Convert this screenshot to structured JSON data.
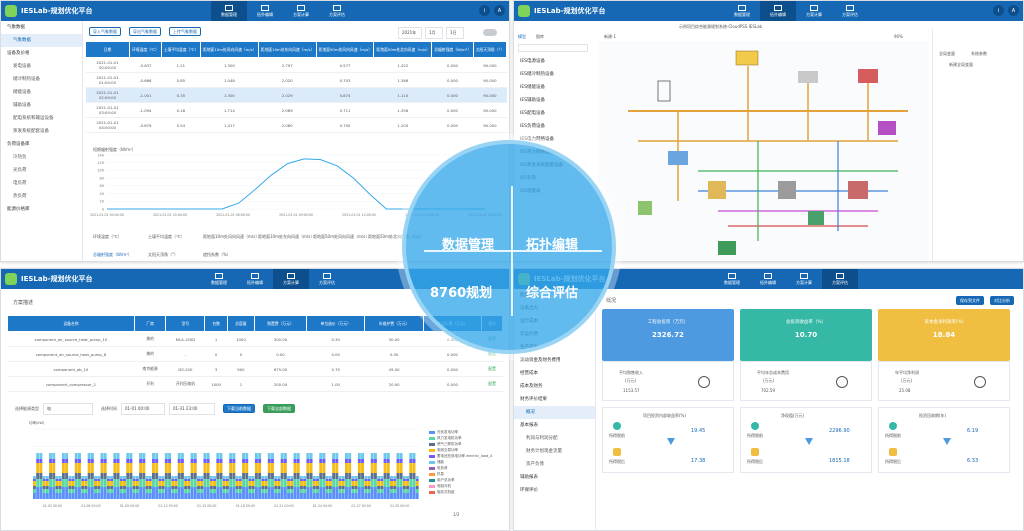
{
  "overlay": {
    "q1": "数据管理",
    "q2": "拓扑编辑",
    "q3": "8760规划",
    "q4": "综合评估"
  },
  "app": {
    "brand": "IESLab-规划优化平台",
    "user": "A",
    "info": "i"
  },
  "nav": [
    "数据管理",
    "拓扑编辑",
    "方案计算",
    "方案评估"
  ],
  "p1": {
    "sidebar": [
      {
        "label": "气象数据",
        "type": "head"
      },
      {
        "label": "气象数据",
        "type": "act"
      },
      {
        "label": "设备及价格",
        "type": "head"
      },
      {
        "label": "发电设备",
        "type": "sub"
      },
      {
        "label": "储冷制热设备",
        "type": "sub"
      },
      {
        "label": "储能设备",
        "type": "sub"
      },
      {
        "label": "辅助设备",
        "type": "sub"
      },
      {
        "label": "配电系统和输运设备",
        "type": "sub"
      },
      {
        "label": "蒸发系统配套设备",
        "type": "sub"
      },
      {
        "label": "负荷设备库",
        "type": "head"
      },
      {
        "label": "冷热负",
        "type": "sub"
      },
      {
        "label": "光负荷",
        "type": "sub"
      },
      {
        "label": "电负荷",
        "type": "sub"
      },
      {
        "label": "热负荷",
        "type": "sub"
      },
      {
        "label": "能源价格库",
        "type": "head"
      }
    ],
    "buttons": [
      "导入气象数据",
      "导出气象数据",
      "上传气象数据"
    ],
    "filters": [
      "2021年",
      "1月",
      "1日"
    ],
    "headers": [
      "日期",
      "环境温度（℃）",
      "土壤平均温度（℃）",
      "距地面10m处风向风速（m/s）",
      "距地面10m处东向风速（m/s）",
      "距地面50m处风向风速（m/s）",
      "距地面50m处北向风速（m/s）",
      "总辐射强度（W/m²）",
      "太阳天顶角（°）"
    ],
    "rows": [
      [
        "2021-01-01 00:00:00",
        "-0.637",
        "1.21",
        "1.300",
        "2.797",
        "0.577",
        "1.422",
        "0.000",
        "90.000"
      ],
      [
        "2021-01-01 01:00:00",
        "-0.666",
        "0.85",
        "1.048",
        "2.020",
        "0.703",
        "1.366",
        "0.000",
        "90.000"
      ],
      [
        "2021-01-01 02:00:00",
        "-1.001",
        "0.35",
        "1.300",
        "2.029",
        "0.874",
        "1.110",
        "0.000",
        "90.000"
      ],
      [
        "2021-01-01 03:00:00",
        "-1.094",
        "0.18",
        "1.714",
        "2.069",
        "0.711",
        "1.356",
        "0.000",
        "90.000"
      ],
      [
        "2021-01-01 04:00:00",
        "-0.879",
        "0.54",
        "1.417",
        "2.080",
        "0.750",
        "1.205",
        "0.000",
        "90.000"
      ]
    ],
    "chart_title": "短期辐射强度（W/m²）",
    "chart_data": {
      "type": "line",
      "yticks": [
        "140",
        "120",
        "100",
        "80",
        "60",
        "40",
        "20",
        "0"
      ],
      "ylim": [
        0,
        140
      ],
      "xticks": [
        "2021-01-01 00:00:00",
        "2021-01-01 03:00:00",
        "2021-01-01 06:00:00",
        "2021-01-01 09:00:00",
        "2021-01-01 12:00:00",
        "2021-01-01 15:00:00",
        "2021-01-01 18:00:00"
      ],
      "x": [
        0,
        7,
        8,
        9,
        10,
        11,
        12,
        13,
        14,
        15,
        16,
        17,
        23
      ],
      "y": [
        0,
        0,
        15,
        50,
        88,
        118,
        130,
        128,
        112,
        80,
        38,
        0,
        0
      ]
    },
    "foot_row1": [
      "环境温度（℃）",
      "土壤平均温度（℃）",
      "距地面10m处风向风速（m/s）",
      "距地面10m处东向风速（m/s）",
      "距地面50m处风向风速（m/s）",
      "距地面50m处北向风速（m/s）"
    ],
    "foot_row2": [
      "总辐射强度（W/m²）",
      "太阳天顶角（°）",
      "遮挡系数（%）"
    ]
  },
  "p2": {
    "tabs": [
      "模型",
      "图库"
    ],
    "file": "新建-1",
    "title": "示例项目综合能源规划系统-CloudPSS IESLab",
    "zoom": "90%",
    "lib": [
      "IES电源设备",
      "IES储冷制热设备",
      "IES储能设备",
      "IES辅助设备",
      "IES配电设备",
      "IES负荷设备",
      "IES电力网络设备",
      "IES热力网络设备",
      "IES蒸发系统配套设备",
      "IES负荷",
      "IES测量表"
    ],
    "right_tabs": [
      "全局变量",
      "系统参数"
    ],
    "right_btn": "新建全局变量"
  },
  "p3": {
    "title": "方案描述",
    "headers": [
      "设备名称",
      "厂商",
      "型号",
      "台数",
      "总容量",
      "购置费（万元）",
      "单位造价（万元）",
      "年维护费（万元）",
      "年运行费（万元）",
      "操作"
    ],
    "rows": [
      [
        "component_air_source_heat_pump_10",
        "美的",
        "MLA-150D",
        "1",
        "1000",
        "300.00",
        "0.30",
        "30.00",
        "0.000",
        "配置"
      ],
      [
        "component_air_source_heat_pump_8",
        "美的",
        "-",
        "0",
        "0",
        "0.00",
        "0.00",
        "0.00",
        "0.000",
        "配置"
      ],
      [
        "component_ab_10",
        "南京能源",
        "DS-200",
        "3",
        "900",
        "675.00",
        "0.75",
        "45.00",
        "0.000",
        "配置"
      ],
      [
        "component_compressor_2",
        "开利",
        "开利压缩机",
        "1000",
        "1",
        "200.00",
        "1.00",
        "20.00",
        "0.000",
        "配置"
      ]
    ],
    "filter_label": "选择能源类型",
    "filter_val": "电",
    "time_label": "选择时间",
    "time_start": "01-01 00:00",
    "time_end": "01-31 23:00",
    "btn1": "下载当前数据",
    "btn2": "下载全部数据",
    "ylabel": "功率(kW)",
    "series": [
      "光伏发电功率",
      "风力发电机功率",
      "燃气三联供功率",
      "电网交易功率",
      "蓄电池充放电功率 electric_load_4",
      "储能",
      "电负荷",
      "热泵",
      "用户总功率",
      "电制冷机",
      "吸收式机组"
    ],
    "series_colors": [
      "#5b8ff9",
      "#5ad8a6",
      "#5d7092",
      "#f6bd16",
      "#6f5ef9",
      "#6dc8ec",
      "#945fb9",
      "#ff9845",
      "#1e9493",
      "#ff99c3",
      "#e8684a"
    ],
    "xticks": [
      "01-03 00:00",
      "01-06 00:00",
      "01-09 00:00",
      "01-12 00:00",
      "01-15 00:00",
      "01-18 00:00",
      "01-21 00:00",
      "01-24 00:00",
      "01-27 00:00",
      "01-30 00:00"
    ],
    "page": "1/2"
  },
  "p4": {
    "side": [
      "能量平衡",
      "设备出力",
      "运行成本",
      "年运行费",
      "生产成本",
      "流动资金及财务费用",
      "经营成本",
      "成本及财务",
      "财务评价结果",
      "概况",
      "基本报表",
      "利润与利润分配",
      "财务计划现金流量",
      "资产负债",
      "辅助报表",
      "环保评价"
    ],
    "title": "概况",
    "btns": [
      "保存到文件",
      "对比分析"
    ],
    "cards": [
      {
        "title": "工程总投资（万元）",
        "value": "2326.72",
        "color": "#4d9ae0"
      },
      {
        "title": "总投资收益率（%）",
        "value": "10.70",
        "color": "#35b8a5"
      },
      {
        "title": "资本金净利润率(%)",
        "value": "18.84",
        "color": "#f0bf42"
      }
    ],
    "cards_sub": [
      {
        "a": "平均购售收入",
        "av": "(万元)",
        "b": "1153.57",
        "c": "平均年总成本费用",
        "cv": "(万元)",
        "d": "702.59",
        "e": "年平均净利润",
        "ev": "(万元)",
        "f": "25.08"
      }
    ],
    "metrics": [
      {
        "title": "项目投资内部收益率(%)",
        "pre": "所得税前",
        "prev": "19.45",
        "post": "所得税后",
        "postv": "17.38"
      },
      {
        "title": "净现值(万元)",
        "pre": "所得税前",
        "prev": "2296.90",
        "post": "所得税后",
        "postv": "1815.18"
      },
      {
        "title": "投资回收期(年)",
        "pre": "所得税前",
        "prev": "6.19",
        "post": "所得税后",
        "postv": "6.33"
      }
    ]
  }
}
